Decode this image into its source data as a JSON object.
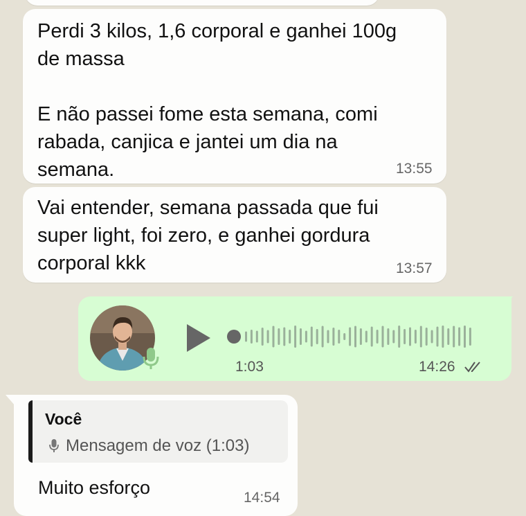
{
  "messages": [
    {
      "direction": "incoming",
      "text": "Perdi 3 kilos, 1,6 corporal e ganhei 100g\nde massa\n\nE não passei fome esta semana, comi\nrabada, canjica e jantei um dia na\nsemana.",
      "time": "13:55"
    },
    {
      "direction": "incoming",
      "text": "Vai entender, semana passada que fui\nsuper light, foi zero, e ganhei gordura\ncorporal kkk",
      "time": "13:57"
    }
  ],
  "voice_message": {
    "direction": "outgoing",
    "duration": "1:03",
    "time": "14:26",
    "status_icon": "double-check-icon",
    "progress": 0.0,
    "colors": {
      "bubble": "#d7fdd3",
      "control": "#666666"
    }
  },
  "reply_message": {
    "direction": "incoming",
    "quote": {
      "author": "Você",
      "icon": "mic-icon",
      "snippet": "Mensagem de voz (1:03)"
    },
    "text": "Muito esforço",
    "time": "14:54"
  },
  "colors": {
    "background": "#e6e2d6",
    "incoming_bubble": "#fdfdfc",
    "outgoing_bubble": "#d7fdd3"
  }
}
